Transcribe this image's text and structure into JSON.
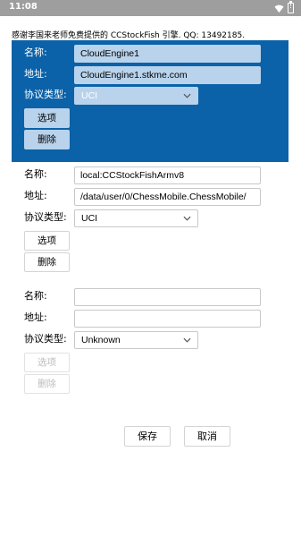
{
  "status_bar": {
    "time": "11:08",
    "wifi_icon": "wifi-icon",
    "battery_icon": "battery-alert-icon"
  },
  "thanks_text": "感谢李国来老师免费提供的 CCStockFish 引擎. QQ: 13492185.",
  "labels": {
    "name": "名称:",
    "address": "地址:",
    "protocol": "协议类型:"
  },
  "buttons": {
    "options": "选项",
    "delete": "删除"
  },
  "engines": [
    {
      "name": "CloudEngine1",
      "address": "CloudEngine1.stkme.com",
      "protocol": "UCI",
      "selected": true,
      "enabled": true
    },
    {
      "name": "local:CCStockFishArmv8",
      "address": "/data/user/0/ChessMobile.ChessMobile/",
      "protocol": "UCI",
      "selected": false,
      "enabled": true
    },
    {
      "name": "",
      "address": "",
      "protocol": "Unknown",
      "selected": false,
      "enabled": false
    }
  ],
  "footer": {
    "save": "保存",
    "cancel": "取消"
  },
  "colors": {
    "selected_panel": "#0b62a8",
    "selected_field": "#b9d3ec",
    "status_bar": "#9e9e9e"
  }
}
